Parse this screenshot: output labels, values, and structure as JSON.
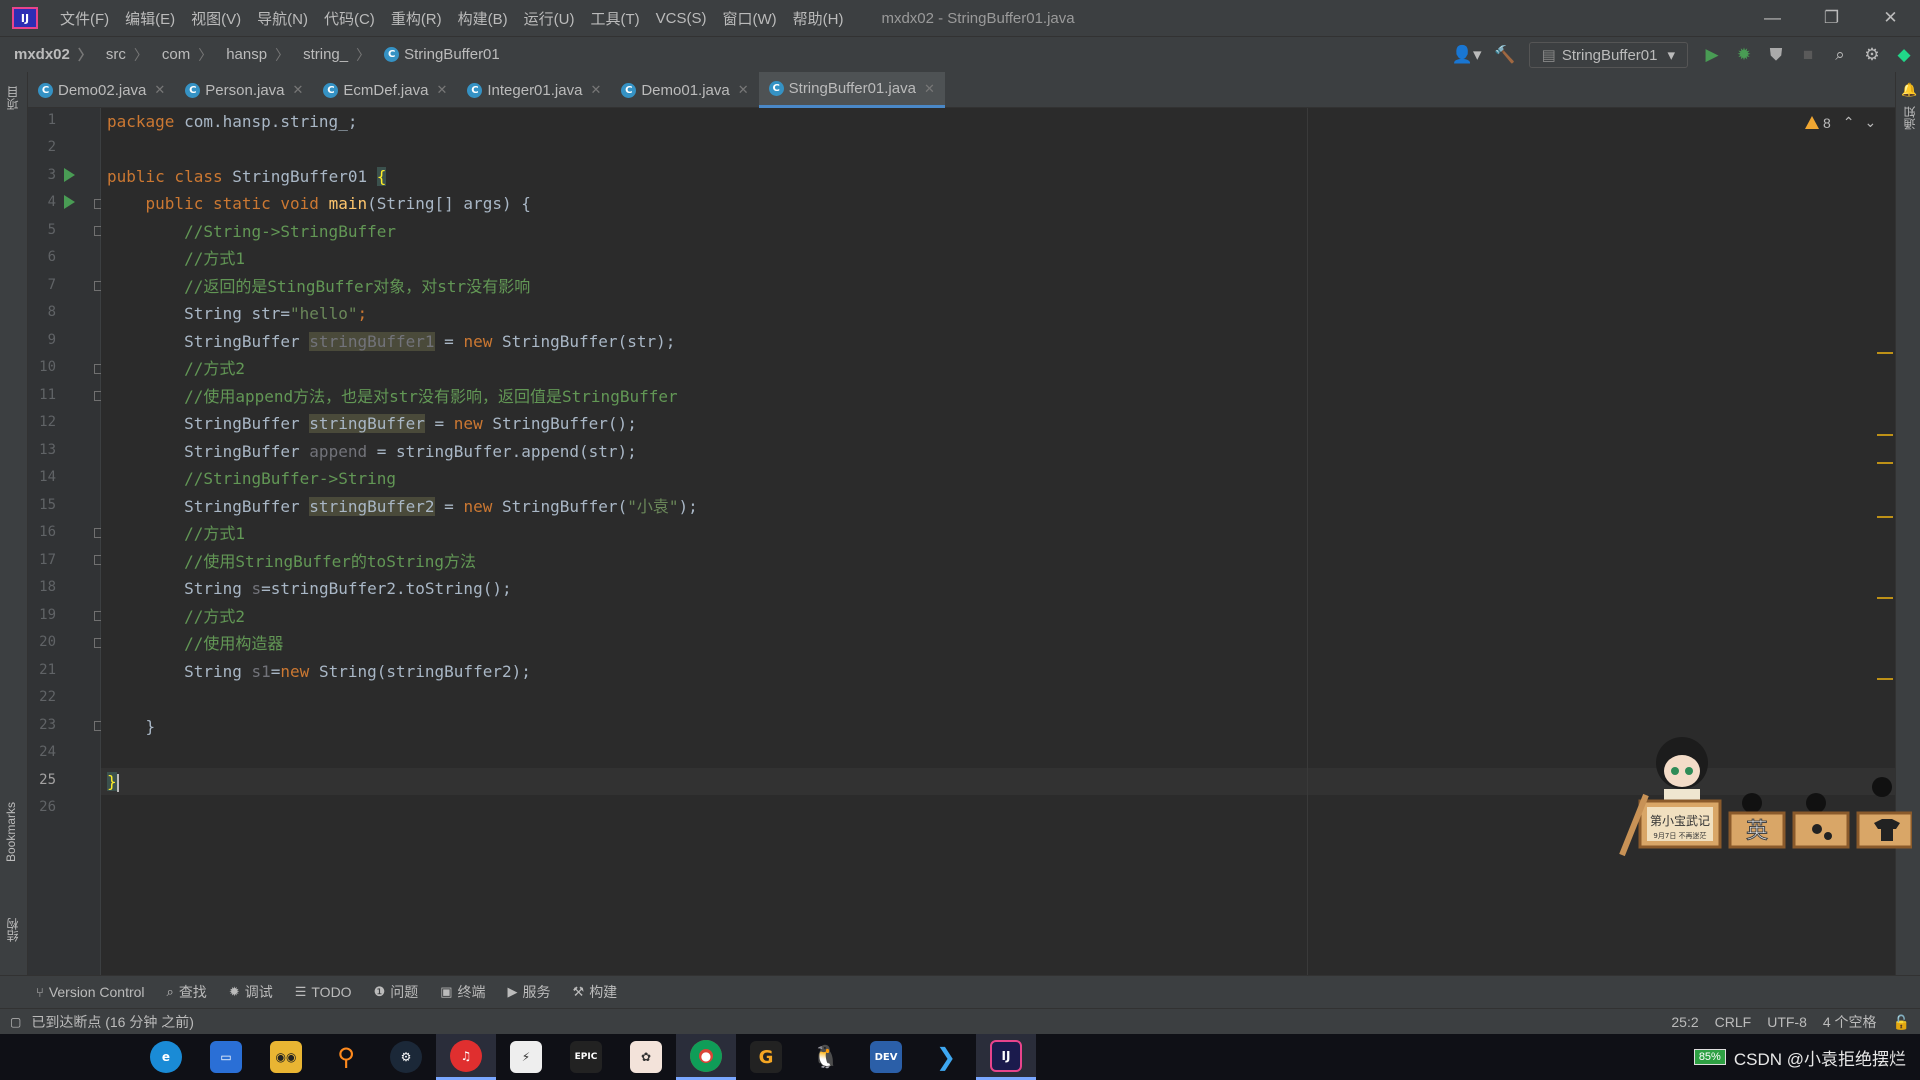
{
  "app": {
    "logo": "IJ",
    "title": "mxdx02 - StringBuffer01.java"
  },
  "menu": [
    "文件(F)",
    "编辑(E)",
    "视图(V)",
    "导航(N)",
    "代码(C)",
    "重构(R)",
    "构建(B)",
    "运行(U)",
    "工具(T)",
    "VCS(S)",
    "窗口(W)",
    "帮助(H)"
  ],
  "breadcrumb": [
    "mxdx02",
    "src",
    "com",
    "hansp",
    "string_",
    "StringBuffer01"
  ],
  "run_config": "StringBuffer01",
  "tabs": [
    "Demo02.java",
    "Person.java",
    "EcmDef.java",
    "Integer01.java",
    "Demo01.java",
    "StringBuffer01.java"
  ],
  "active_tab": "StringBuffer01.java",
  "left_strip": {
    "project": "项目",
    "bookmarks": "Bookmarks",
    "structure": "结构"
  },
  "right_strip": {
    "notifications": "通知"
  },
  "inspections": {
    "warnings": "8"
  },
  "line_numbers": [
    "1",
    "2",
    "3",
    "4",
    "5",
    "6",
    "7",
    "8",
    "9",
    "10",
    "11",
    "12",
    "13",
    "14",
    "15",
    "16",
    "17",
    "18",
    "19",
    "20",
    "21",
    "22",
    "23",
    "24",
    "25",
    "26"
  ],
  "code": {
    "l1a": "package ",
    "l1b": "com.hansp.string_;",
    "l3a": "public class ",
    "l3b": "StringBuffer01 ",
    "l3c": "{",
    "l4a": "    public static void ",
    "l4b": "main",
    "l4c": "(String[] args) {",
    "l5": "        //String->StringBuffer",
    "l6": "        //方式1",
    "l7": "        //返回的是StingBuffer对象，对str没有影响",
    "l8a": "        String str=",
    "l8b": "\"hello\"",
    "l8c": ";",
    "l9a": "        StringBuffer ",
    "l9b": "stringBuffer1",
    "l9c": " = ",
    "l9d": "new ",
    "l9e": "StringBuffer(str);",
    "l10": "        //方式2",
    "l11": "        //使用append方法，也是对str没有影响，返回值是StringBuffer",
    "l12a": "        StringBuffer ",
    "l12b": "stringBuffer",
    "l12c": " = ",
    "l12d": "new ",
    "l12e": "StringBuffer();",
    "l13a": "        StringBuffer ",
    "l13b": "append",
    "l13c": " = stringBuffer.append(str);",
    "l14": "        //StringBuffer->String",
    "l15a": "        StringBuffer ",
    "l15b": "stringBuffer2",
    "l15c": " = ",
    "l15d": "new ",
    "l15e": "StringBuffer(",
    "l15f": "\"小袁\"",
    "l15g": ");",
    "l16": "        //方式1",
    "l17": "        //使用StringBuffer的toString方法",
    "l18a": "        String ",
    "l18b": "s",
    "l18c": "=stringBuffer2.toString();",
    "l19": "        //方式2",
    "l20": "        //使用构造器",
    "l21a": "        String ",
    "l21b": "s1",
    "l21c": "=",
    "l21d": "new ",
    "l21e": "String(stringBuffer2);",
    "l23": "    }",
    "l25": "}"
  },
  "bottom_tools": [
    "Version Control",
    "查找",
    "调试",
    "TODO",
    "问题",
    "终端",
    "服务",
    "构建"
  ],
  "status": {
    "message": "已到达断点 (16 分钟 之前)",
    "position": "25:2",
    "line_sep": "CRLF",
    "encoding": "UTF-8",
    "indent": "4 个空格"
  },
  "mascot": {
    "sign": "第小宝武记",
    "date": "9月7日 不再迷茫",
    "box": "英"
  },
  "tray": {
    "battery": "85%",
    "watermark": "CSDN @小袁拒绝摆烂"
  },
  "colors": {
    "accent": "#4a88c7",
    "keyword": "#cc7832",
    "comment": "#629755",
    "string": "#6a8759"
  }
}
